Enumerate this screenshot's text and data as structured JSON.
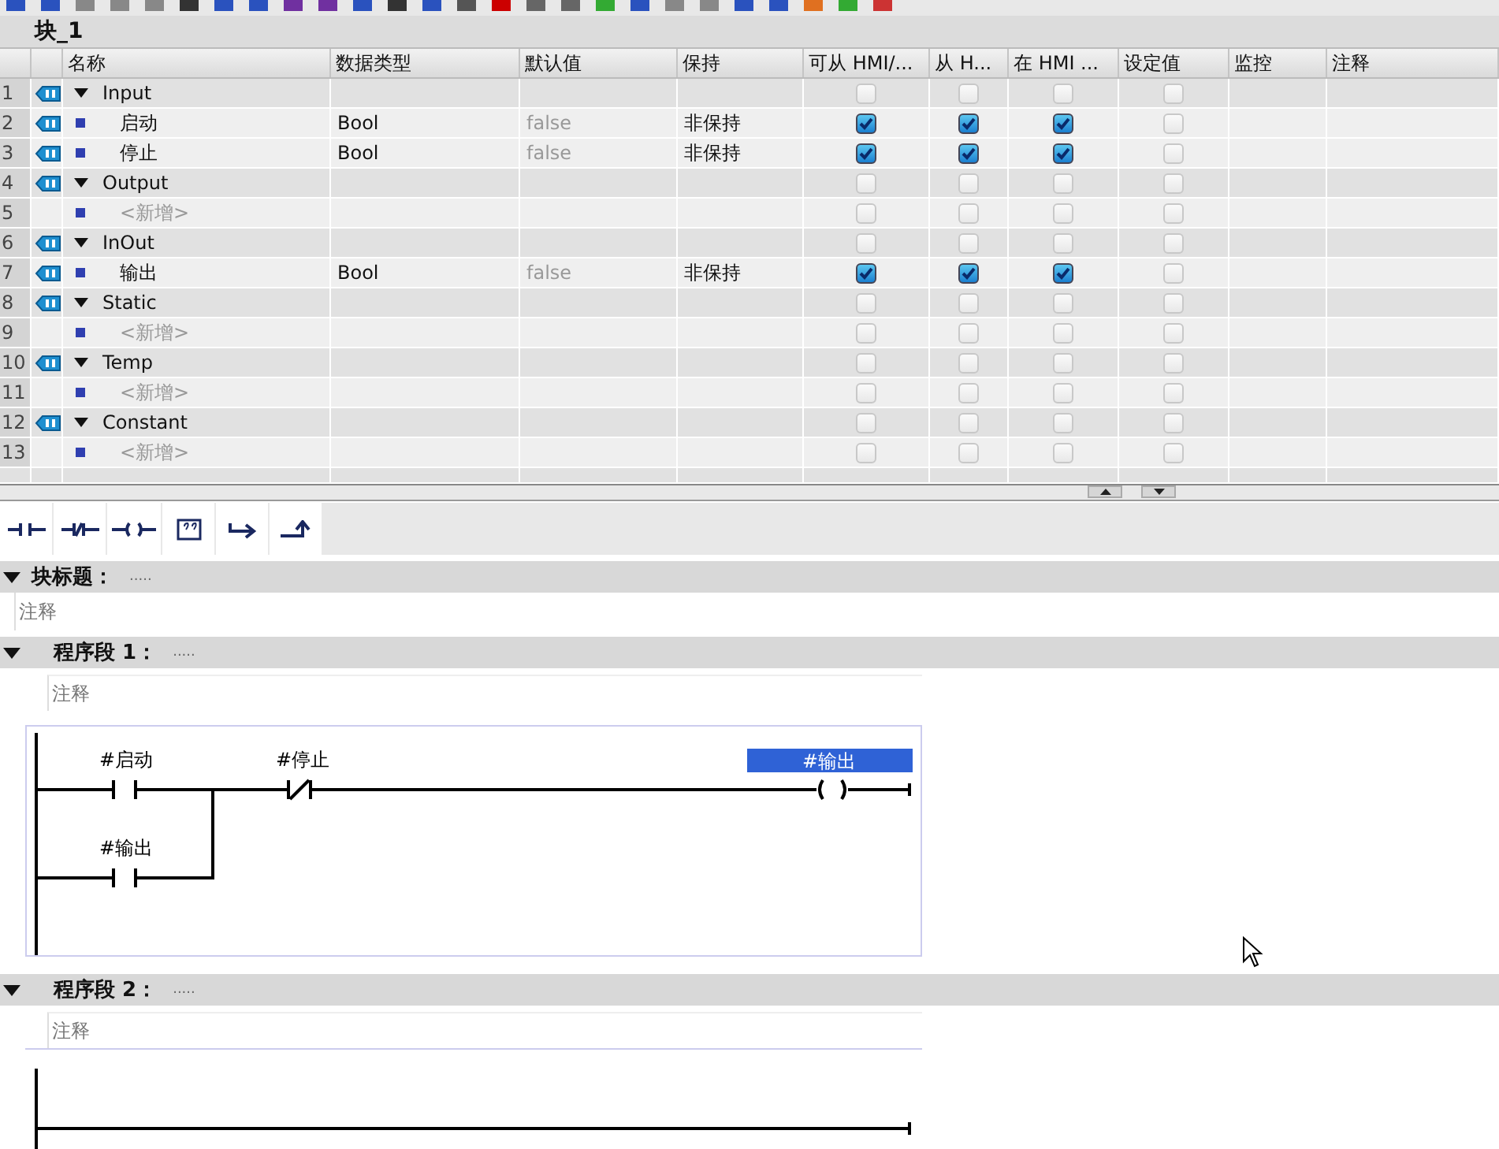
{
  "block": {
    "title": "块_1"
  },
  "interface_table": {
    "columns": [
      "名称",
      "数据类型",
      "默认值",
      "保持",
      "可从 HMI/...",
      "从 H...",
      "在 HMI ...",
      "设定值",
      "监控",
      "注释"
    ],
    "rows": [
      {
        "number": "1",
        "kind": "section",
        "name": "Input",
        "expanded": true,
        "checks": [
          false,
          false,
          false,
          false
        ]
      },
      {
        "number": "2",
        "kind": "variable",
        "name": "启动",
        "data_type": "Bool",
        "default": "false",
        "retain": "非保持",
        "checks": [
          true,
          true,
          true,
          false
        ]
      },
      {
        "number": "3",
        "kind": "variable",
        "name": "停止",
        "data_type": "Bool",
        "default": "false",
        "retain": "非保持",
        "checks": [
          true,
          true,
          true,
          false
        ]
      },
      {
        "number": "4",
        "kind": "section",
        "name": "Output",
        "expanded": true,
        "checks": [
          false,
          false,
          false,
          false
        ]
      },
      {
        "number": "5",
        "kind": "add",
        "name": "<新增>",
        "checks": [
          false,
          false,
          false,
          false
        ]
      },
      {
        "number": "6",
        "kind": "section",
        "name": "InOut",
        "expanded": true,
        "checks": [
          false,
          false,
          false,
          false
        ]
      },
      {
        "number": "7",
        "kind": "variable",
        "name": "输出",
        "data_type": "Bool",
        "default": "false",
        "retain": "非保持",
        "checks": [
          true,
          true,
          true,
          false
        ]
      },
      {
        "number": "8",
        "kind": "section",
        "name": "Static",
        "expanded": true,
        "checks": [
          false,
          false,
          false,
          false
        ]
      },
      {
        "number": "9",
        "kind": "add",
        "name": "<新增>",
        "checks": [
          false,
          false,
          false,
          false
        ]
      },
      {
        "number": "10",
        "kind": "section",
        "name": "Temp",
        "expanded": true,
        "checks": [
          false,
          false,
          false,
          false
        ]
      },
      {
        "number": "11",
        "kind": "add",
        "name": "<新增>",
        "checks": [
          false,
          false,
          false,
          false
        ]
      },
      {
        "number": "12",
        "kind": "section",
        "name": "Constant",
        "expanded": true,
        "checks": [
          false,
          false,
          false,
          false
        ]
      },
      {
        "number": "13",
        "kind": "add",
        "name": "<新增>",
        "checks": [
          false,
          false,
          false,
          false
        ]
      }
    ]
  },
  "block_title": {
    "label": "块标题：",
    "dots": ".....",
    "comment": "注释",
    "expanded": true
  },
  "networks": [
    {
      "label": "程序段 1：",
      "dots": ".....",
      "comment": "注释",
      "expanded": true,
      "kind": "rung",
      "operands": [
        {
          "text": "#启动",
          "selected": false
        },
        {
          "text": "#输出",
          "selected": false
        },
        {
          "text": "#停止",
          "selected": false
        },
        {
          "text": "#输出",
          "selected": true
        }
      ]
    },
    {
      "label": "程序段 2：",
      "dots": ".....",
      "comment": "注释",
      "expanded": true,
      "kind": "empty"
    }
  ]
}
